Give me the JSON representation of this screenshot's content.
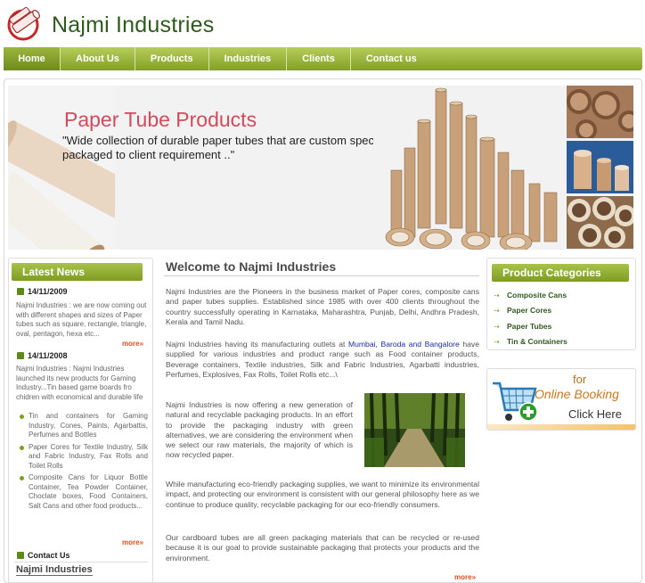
{
  "header": {
    "title": "Najmi Industries",
    "logo_icon": "paper-tube-logo-icon"
  },
  "nav": {
    "items": [
      "Home",
      "About Us",
      "Products",
      "Industries",
      "Clients",
      "Contact us"
    ]
  },
  "banner": {
    "title": "Paper Tube Products",
    "subtitle": "\"Wide collection of durable paper tubes that are custom specific and packaged to client requirement ..\""
  },
  "latest_news": {
    "heading": "Latest News",
    "items": [
      {
        "date": "14/11/2009",
        "text": "Najmi Industries : we are now coming out with different shapes and sizes of Paper tubes such as square, rectangle, triangle, oval, pentagon, hexa etc...",
        "more": "more»"
      },
      {
        "date": "14/11/2008",
        "text": "Najmi Industries : Najmi Industries launched its new products for Gaming Industry...Tin based game boards fro chidren with economical and durable life",
        "sub": [
          "Tin and containers for Gaming Industry, Cones, Paints, Agarbattis, Perfumes and Bottles",
          "Paper Cores for Textile Industry, Silk and Fabric Industry, Fax Rolls and Toilet Rolls",
          "Composite Cans for Liquor Bottle Container, Tea Powder Container, Choclate boxes, Food Containers, Salt Cans and other food products..."
        ],
        "more": "more»"
      }
    ]
  },
  "contact": {
    "heading": "Contact Us",
    "company": "Najmi Industries"
  },
  "welcome": {
    "heading": "Welcome to Najmi Industries",
    "p1": "Najmi Industries are the Pioneers in the business market of Paper cores, composite cans and paper tubes supplies. Established since 1985 with over 400 clients throughout the country successfully operating in Karnataka, Maharashtra, Punjab, Delhi, Andhra Pradesh, Kerala and Tamil Nadu.",
    "p2_start": "Najmi Industries having its manufacturing outlets at ",
    "p2_cities": "Mumbai, Baroda and Bangalore",
    "p2_end": " have supplied for various industries and product range such as Food container products, Beverage containers, Textile industries, Silk and Fabric Industries, Agarbatti industries, Perfumes, Explosives, Fax Rolls, Toilet Rolls etc...\\",
    "p3": "Najmi Industries is now offering a new generation of natural and recyclable packaging products. In an effort to provide the packaging industry with green alternatives, we are considering the environment when we select our raw materials, the majority of which is now recycled paper.",
    "p4": "While manufacturing eco-friendly packaging supplies, we want to minimize its environmental impact, and protecting our environment is consistent with our general philosophy here as we continue to produce quality, recyclable packaging for our eco-friendly consumers.",
    "p5": "Our cardboard tubes are all green packaging materials that can be recycled or re-used because it is our goal to provide sustainable packaging that protects your products and the environment.",
    "more": "more»"
  },
  "categories": {
    "heading": "Product Categories",
    "items": [
      "Composite Cans",
      "Paper Cores",
      "Paper Tubes",
      "Tin & Containers"
    ]
  },
  "booking": {
    "line1": "for",
    "line2": "Online Booking",
    "line3": "Click Here",
    "icon": "shopping-cart-icon"
  }
}
